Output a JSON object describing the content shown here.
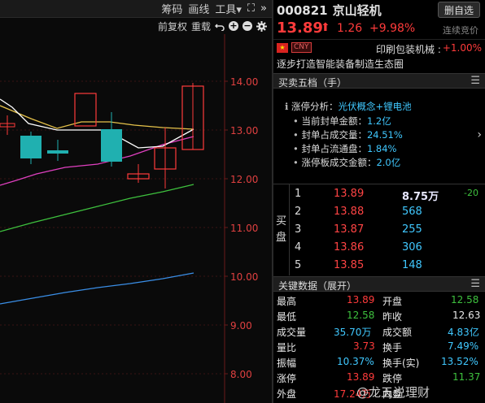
{
  "toolbar": {
    "items": [
      "筹码",
      "画线",
      "工具▾"
    ],
    "expand": "⛶",
    "collapse": "»",
    "row2": [
      "前复权",
      "重载"
    ]
  },
  "chart": {
    "price_labels": [
      "14.00",
      "13.00",
      "12.00",
      "11.00",
      "10.00",
      "9.00",
      "8.00"
    ]
  },
  "stock": {
    "code": "000821",
    "name": "京山轻机",
    "favorite_btn": "删自选",
    "price": "13.89",
    "change": "1.26",
    "change_pct": "+9.98%",
    "auction": "连续竞价",
    "currency": "CNY",
    "sector": "印刷包装机械 :",
    "sector_pct": "+1.00%",
    "slogan": "逐步打造智能装备制造生态圈"
  },
  "level5": {
    "title": "买卖五档（手）",
    "analysis": {
      "label": "涨停分析：",
      "value": "光伏概念+锂电池",
      "items": [
        {
          "label": "当前封单金额：",
          "value": "1.2亿"
        },
        {
          "label": "封单占成交量：",
          "value": "24.51%"
        },
        {
          "label": "封单占流通盘：",
          "value": "1.84%"
        },
        {
          "label": "涨停板成交金额：",
          "value": "2.0亿"
        }
      ]
    },
    "side_label": [
      "买",
      "盘"
    ],
    "bids": [
      {
        "n": "1",
        "price": "13.89",
        "qty": "8.75万",
        "delta": "-20"
      },
      {
        "n": "2",
        "price": "13.88",
        "qty": "568",
        "delta": ""
      },
      {
        "n": "3",
        "price": "13.87",
        "qty": "255",
        "delta": ""
      },
      {
        "n": "4",
        "price": "13.86",
        "qty": "306",
        "delta": ""
      },
      {
        "n": "5",
        "price": "13.85",
        "qty": "148",
        "delta": ""
      }
    ]
  },
  "key_data": {
    "title": "关键数据（展开）",
    "rows": [
      {
        "l1": "最高",
        "v1": "13.89",
        "l2": "开盘",
        "v2": "12.58"
      },
      {
        "l1": "最低",
        "v1": "12.58",
        "l2": "昨收",
        "v2": "12.63"
      },
      {
        "l1": "成交量",
        "v1": "35.70万",
        "l2": "成交额",
        "v2": "4.83亿"
      },
      {
        "l1": "量比",
        "v1": "3.73",
        "l2": "换手",
        "v2": "7.49%"
      },
      {
        "l1": "振幅",
        "v1": "10.37%",
        "l2": "换手(实)",
        "v2": "13.52%"
      },
      {
        "l1": "涨停",
        "v1": "13.89",
        "l2": "跌停",
        "v2": "11.37"
      },
      {
        "l1": "外盘",
        "v1": "17.24万",
        "l2": "内盘",
        "v2": ""
      }
    ]
  },
  "watermark": "@龙五说理财",
  "colors": {
    "up": "#ff3b3b",
    "down": "#3ec13e",
    "bg": "#000000",
    "ma5": "#ffffff",
    "ma10": "#e6c24a",
    "ma20": "#e040c0",
    "ma60": "#3ec13e",
    "ma120": "#3a8ee6"
  }
}
